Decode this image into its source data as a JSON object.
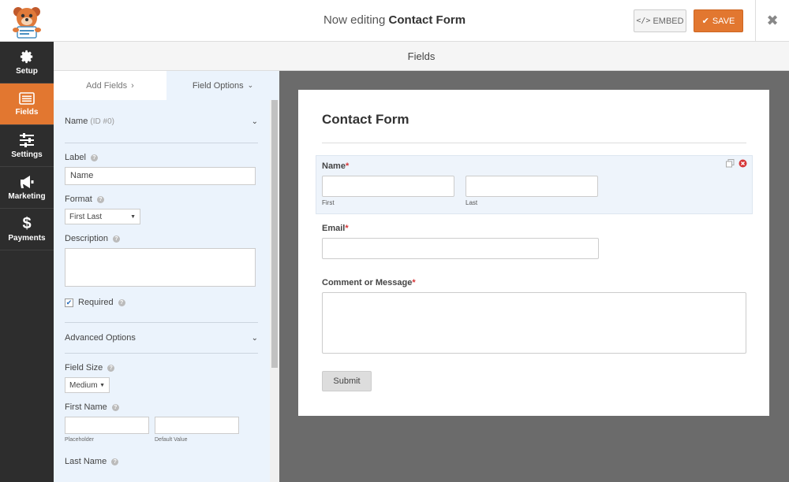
{
  "header": {
    "title_prefix": "Now editing",
    "form_name": "Contact Form",
    "embed_label": "EMBED",
    "save_label": "SAVE"
  },
  "nav": {
    "items": [
      {
        "label": "Setup",
        "icon": "gear-icon"
      },
      {
        "label": "Fields",
        "icon": "fields-list-icon",
        "active": true
      },
      {
        "label": "Settings",
        "icon": "sliders-icon"
      },
      {
        "label": "Marketing",
        "icon": "megaphone-icon"
      },
      {
        "label": "Payments",
        "icon": "dollar-icon"
      }
    ]
  },
  "panel": {
    "title": "Fields"
  },
  "tabs": {
    "add_fields": "Add Fields",
    "field_options": "Field Options"
  },
  "options": {
    "field_name": "Name",
    "field_id": "(ID #0)",
    "label_label": "Label",
    "label_value": "Name",
    "format_label": "Format",
    "format_value": "First Last",
    "description_label": "Description",
    "required_label": "Required",
    "required_checked": true,
    "advanced_label": "Advanced Options",
    "field_size_label": "Field Size",
    "field_size_value": "Medium",
    "first_name_label": "First Name",
    "placeholder_caption": "Placeholder",
    "default_value_caption": "Default Value",
    "last_name_label": "Last Name"
  },
  "preview": {
    "form_title": "Contact Form",
    "name_label": "Name",
    "first_caption": "First",
    "last_caption": "Last",
    "email_label": "Email",
    "comment_label": "Comment or Message",
    "required_mark": "*",
    "submit_label": "Submit"
  },
  "colors": {
    "accent": "#e27730",
    "nav_bg": "#2d2d2d",
    "sidebar_bg": "#ebf3fc",
    "preview_bg": "#6b6b6b"
  }
}
